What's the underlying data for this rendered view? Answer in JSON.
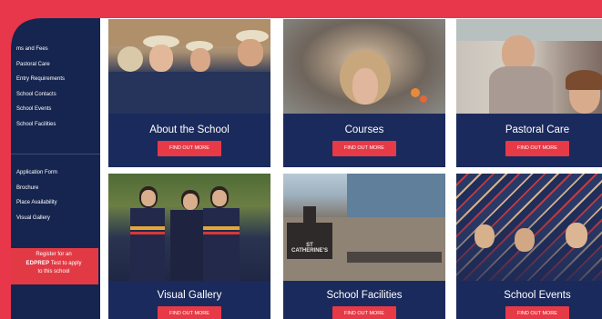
{
  "sidebar": {
    "nav_primary": [
      {
        "label": "ms and Fees"
      },
      {
        "label": "Pastoral Care"
      },
      {
        "label": "Entry Requirements"
      },
      {
        "label": "School Contacts"
      },
      {
        "label": "School Events"
      },
      {
        "label": "School Facilities"
      }
    ],
    "nav_secondary": [
      {
        "label": "Application Form"
      },
      {
        "label": "Brochure"
      },
      {
        "label": "Place Availability"
      },
      {
        "label": "Visual Gallery"
      }
    ],
    "register": {
      "line1": "Register for an",
      "brand": "EDPREP",
      "line2": "Test to apply",
      "line3": "to this school"
    }
  },
  "cards": [
    {
      "title": "About the School",
      "button": "FIND OUT MORE"
    },
    {
      "title": "Courses",
      "button": "FIND OUT MORE"
    },
    {
      "title": "Pastoral Care",
      "button": "FIND OUT MORE"
    },
    {
      "title": "Visual Gallery",
      "button": "FIND OUT MORE"
    },
    {
      "title": "School Facilities",
      "button": "FIND OUT MORE"
    },
    {
      "title": "School Events",
      "button": "FIND OUT MORE"
    }
  ],
  "signage": {
    "text": "ST CATHERINE'S"
  },
  "colors": {
    "frame_red": "#e8364a",
    "navy": "#16254f",
    "card_navy": "#1b2a5c",
    "button_red": "#e63a47"
  }
}
